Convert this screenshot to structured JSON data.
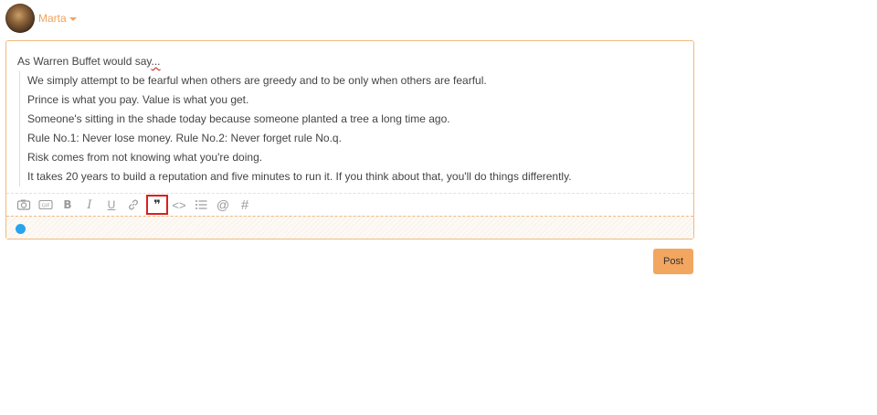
{
  "user": {
    "name": "Marta"
  },
  "editor": {
    "intro": "As Warren Buffet would say",
    "intro_suffix": "...",
    "quote_lines": [
      "We simply attempt to be fearful when others are greedy and to be only when others are fearful.",
      "Prince is what you pay. Value is what you get.",
      "Someone's sitting in the shade today because someone planted a tree a long time ago.",
      "Rule No.1: Never lose money. Rule No.2: Never forget rule No.q.",
      "Risk comes from not knowing what you're doing.",
      "It takes 20 years to build a reputation and five minutes to run it. If you think about that, you'll do things differently."
    ]
  },
  "toolbar": {
    "items": [
      "camera-icon",
      "gif-icon",
      "bold-icon",
      "italic-icon",
      "underline-icon",
      "link-icon",
      "quote-icon",
      "code-icon",
      "list-icon",
      "mention-icon",
      "hashtag-icon"
    ],
    "gif_label": "GIF",
    "bold_label": "B",
    "italic_label": "I",
    "underline_label": "U",
    "quote_glyph": "❞",
    "code_glyph": "<>",
    "mention_glyph": "@",
    "hash_glyph": "#",
    "active_item": "quote-icon"
  },
  "status": {
    "dot_color": "#2aa3ef"
  },
  "actions": {
    "post_label": "Post"
  },
  "colors": {
    "accent": "#f3a660",
    "active_border": "#d9201f"
  }
}
